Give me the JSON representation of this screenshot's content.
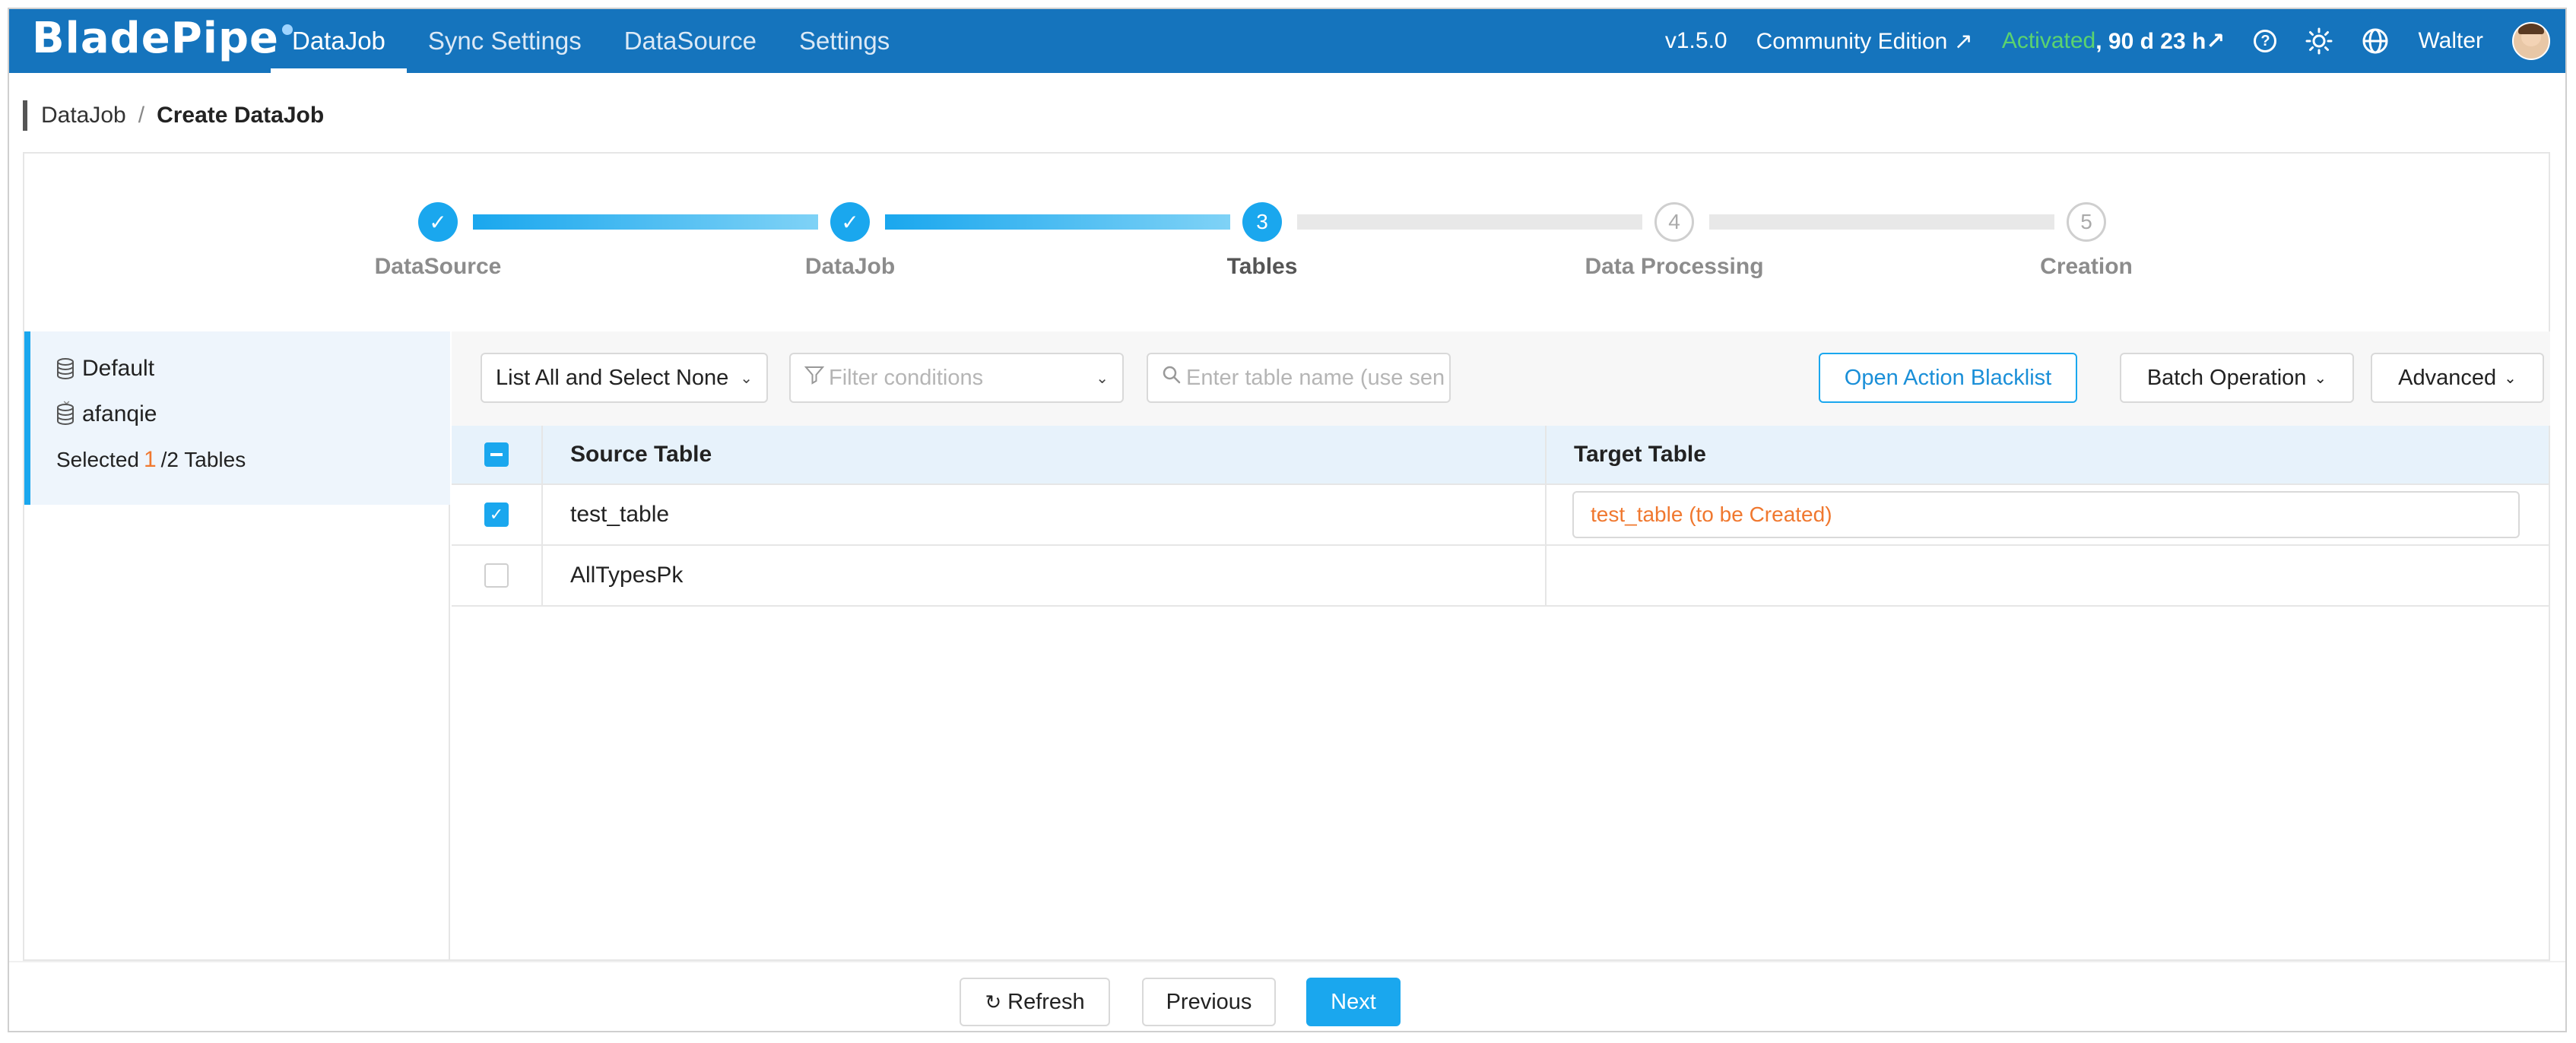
{
  "app": {
    "logo_text": "BladePipe"
  },
  "nav": {
    "items": [
      {
        "label": "DataJob"
      },
      {
        "label": "Sync Settings"
      },
      {
        "label": "DataSource"
      },
      {
        "label": "Settings"
      }
    ],
    "active": "DataJob",
    "version": "v1.5.0",
    "edition": "Community Edition ↗",
    "activated_label": "Activated",
    "remaining": ", 90 d 23 h↗",
    "user": "Walter"
  },
  "breadcrumb": {
    "parent": "DataJob",
    "separator": "/",
    "current": "Create DataJob"
  },
  "steps": [
    {
      "label": "DataSource",
      "state": "done"
    },
    {
      "label": "DataJob",
      "state": "done"
    },
    {
      "label": "Tables",
      "state": "current",
      "number": "3"
    },
    {
      "label": "Data Processing",
      "state": "pending",
      "number": "4"
    },
    {
      "label": "Creation",
      "state": "pending",
      "number": "5"
    }
  ],
  "tree": {
    "root": "Default",
    "schema": "afanqie",
    "selected_prefix": "Selected",
    "selected_count": "1",
    "selected_suffix": "/2 Tables"
  },
  "toolbar": {
    "list_mode": "List All and Select None",
    "filter_placeholder": "Filter conditions",
    "search_placeholder": "Enter table name (use sen",
    "blacklist_button": "Open Action Blacklist",
    "batch_button": "Batch Operation",
    "advanced_button": "Advanced"
  },
  "table": {
    "headers": {
      "source": "Source Table",
      "target": "Target Table"
    },
    "rows": [
      {
        "source": "test_table",
        "target": "test_table (to be Created)",
        "checked": true
      },
      {
        "source": "AllTypesPk",
        "target": "",
        "checked": false
      }
    ]
  },
  "footer": {
    "refresh": "Refresh",
    "previous": "Previous",
    "next": "Next"
  },
  "colors": {
    "nav_bg": "#1574bd",
    "accent": "#1aa7ee",
    "warning_text": "#f0782f",
    "activated": "#5bd36e"
  }
}
